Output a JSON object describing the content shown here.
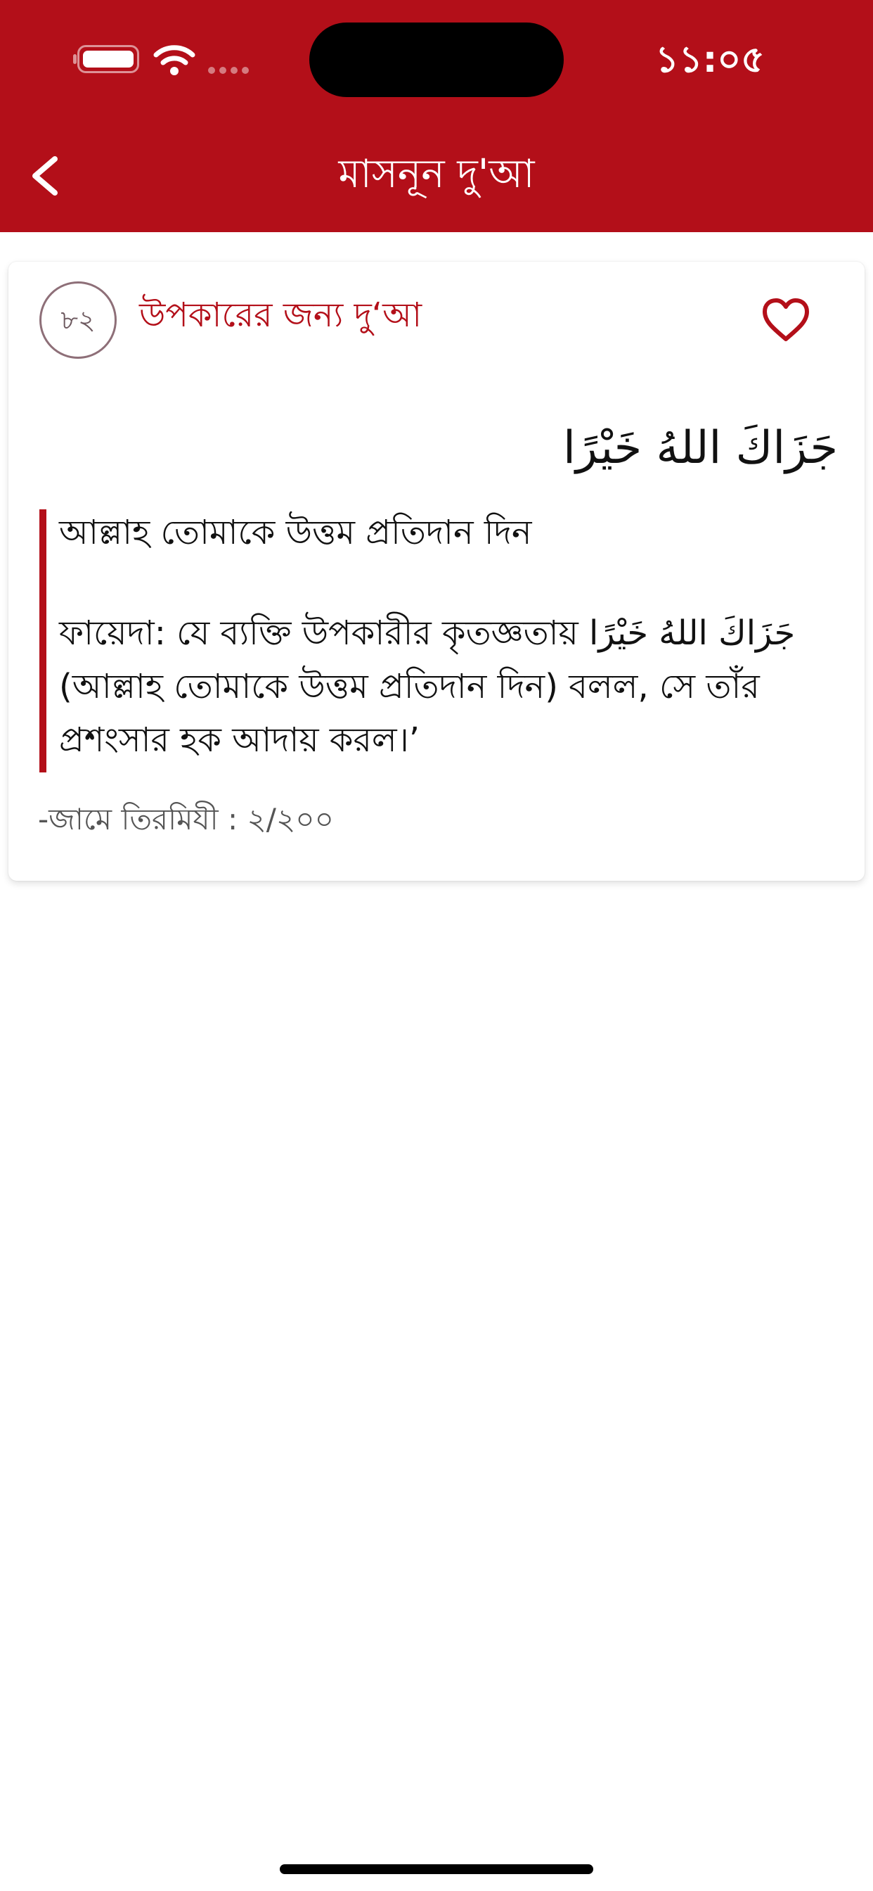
{
  "status_bar": {
    "time": "১১:০৫",
    "icons": [
      "battery-icon",
      "wifi-icon",
      "signal-icon"
    ]
  },
  "header": {
    "title": "মাসনূন দু'আ",
    "back_icon": "chevron-left-icon"
  },
  "dua": {
    "number": "৮২",
    "title": "উপকারের জন্য দু‘আ",
    "favorite_icon": "heart-outline-icon",
    "arabic": "جَزَاكَ اللهُ خَيْرًا",
    "translation": "আল্লাহ তোমাকে উত্তম প্রতিদান দিন",
    "benefit_prefix": "ফায়েদা: যে ব্যক্তি উপকারীর কৃতজ্ঞতায়",
    "benefit_arabic": "جَزَاكَ اللهُ خَيْرًا",
    "benefit_suffix": "(আল্লাহ তোমাকে উত্তম প্রতিদান দিন) বলল, সে তাঁর প্রশংসার হক আদায় করল।’",
    "reference": "-জামে তিরমিযী : ২/২০০"
  },
  "colors": {
    "primary": "#B30F19",
    "text": "#111111",
    "muted": "#555555"
  }
}
